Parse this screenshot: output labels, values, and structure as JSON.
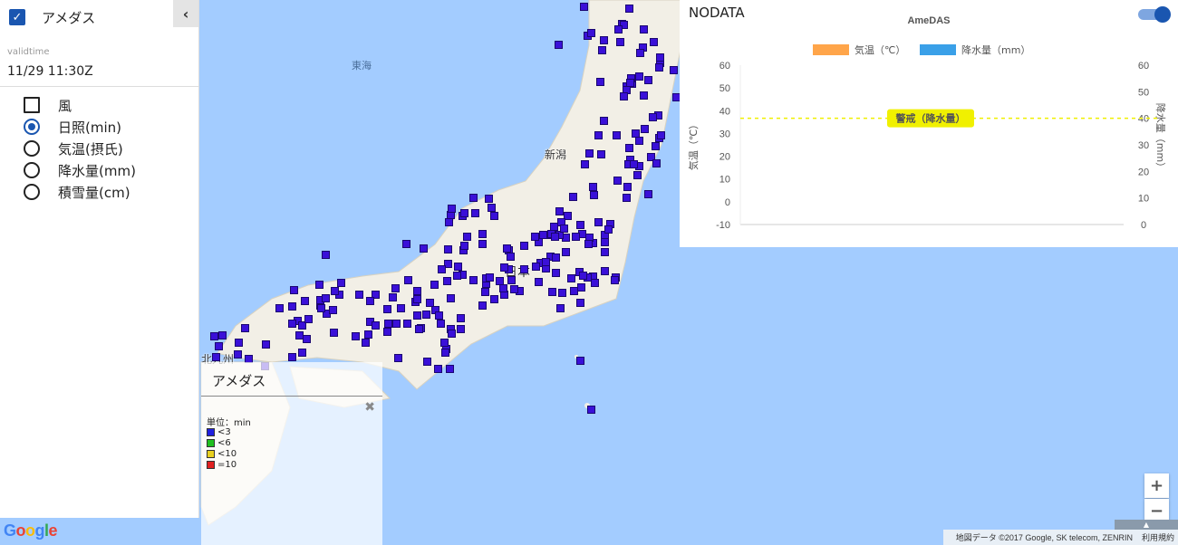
{
  "layer": {
    "title": "アメダス",
    "checked": true,
    "collapse_icon": "chevron-left-icon"
  },
  "validtime": {
    "label": "validtime",
    "value": "11/29 11:30Z"
  },
  "options": [
    {
      "label": "風",
      "type": "checkbox",
      "selected": false
    },
    {
      "label": "日照(min)",
      "type": "radio",
      "selected": true
    },
    {
      "label": "気温(摂氏)",
      "type": "radio",
      "selected": false
    },
    {
      "label": "降水量(mm)",
      "type": "radio",
      "selected": false
    },
    {
      "label": "積雪量(cm)",
      "type": "radio",
      "selected": false
    }
  ],
  "map": {
    "sea_label": "東海",
    "city_labels": [
      "新潟",
      "日本",
      "北九州"
    ],
    "attribution": "地図データ ©2017 Google, SK telecom, ZENRIN",
    "terms": "利用規約",
    "google_logo": "Google",
    "zoom_in": "+",
    "zoom_out": "−",
    "station_color": "#3a10d8"
  },
  "legend": {
    "title": "アメダス",
    "unit": "単位：min",
    "close_icon": "close-icon",
    "items": [
      {
        "label": "<3",
        "color": "#2020e0"
      },
      {
        "label": "<6",
        "color": "#20c020"
      },
      {
        "label": "<10",
        "color": "#e8d020"
      },
      {
        "label": "=10",
        "color": "#e02020"
      }
    ]
  },
  "chart_panel": {
    "status": "NODATA",
    "toggle_on": true
  },
  "chart_data": {
    "type": "bar",
    "title": "AmeDAS",
    "series": [
      {
        "name": "気温（℃）",
        "color": "#ffa54a",
        "values": []
      },
      {
        "name": "降水量（mm）",
        "color": "#3aa0e8",
        "values": []
      }
    ],
    "y_left": {
      "label": "気温（℃）",
      "ticks": [
        "60",
        "50",
        "40",
        "30",
        "20",
        "10",
        "0",
        "-10"
      ],
      "range": [
        -10,
        60
      ]
    },
    "y_right": {
      "label": "降水量（mm）",
      "ticks": [
        "60",
        "50",
        "40",
        "30",
        "20",
        "10",
        "0"
      ],
      "range": [
        0,
        60
      ]
    },
    "threshold": {
      "label": "警戒（降水量）",
      "value": 40,
      "color": "#f0f000"
    },
    "legend_position": "top"
  }
}
